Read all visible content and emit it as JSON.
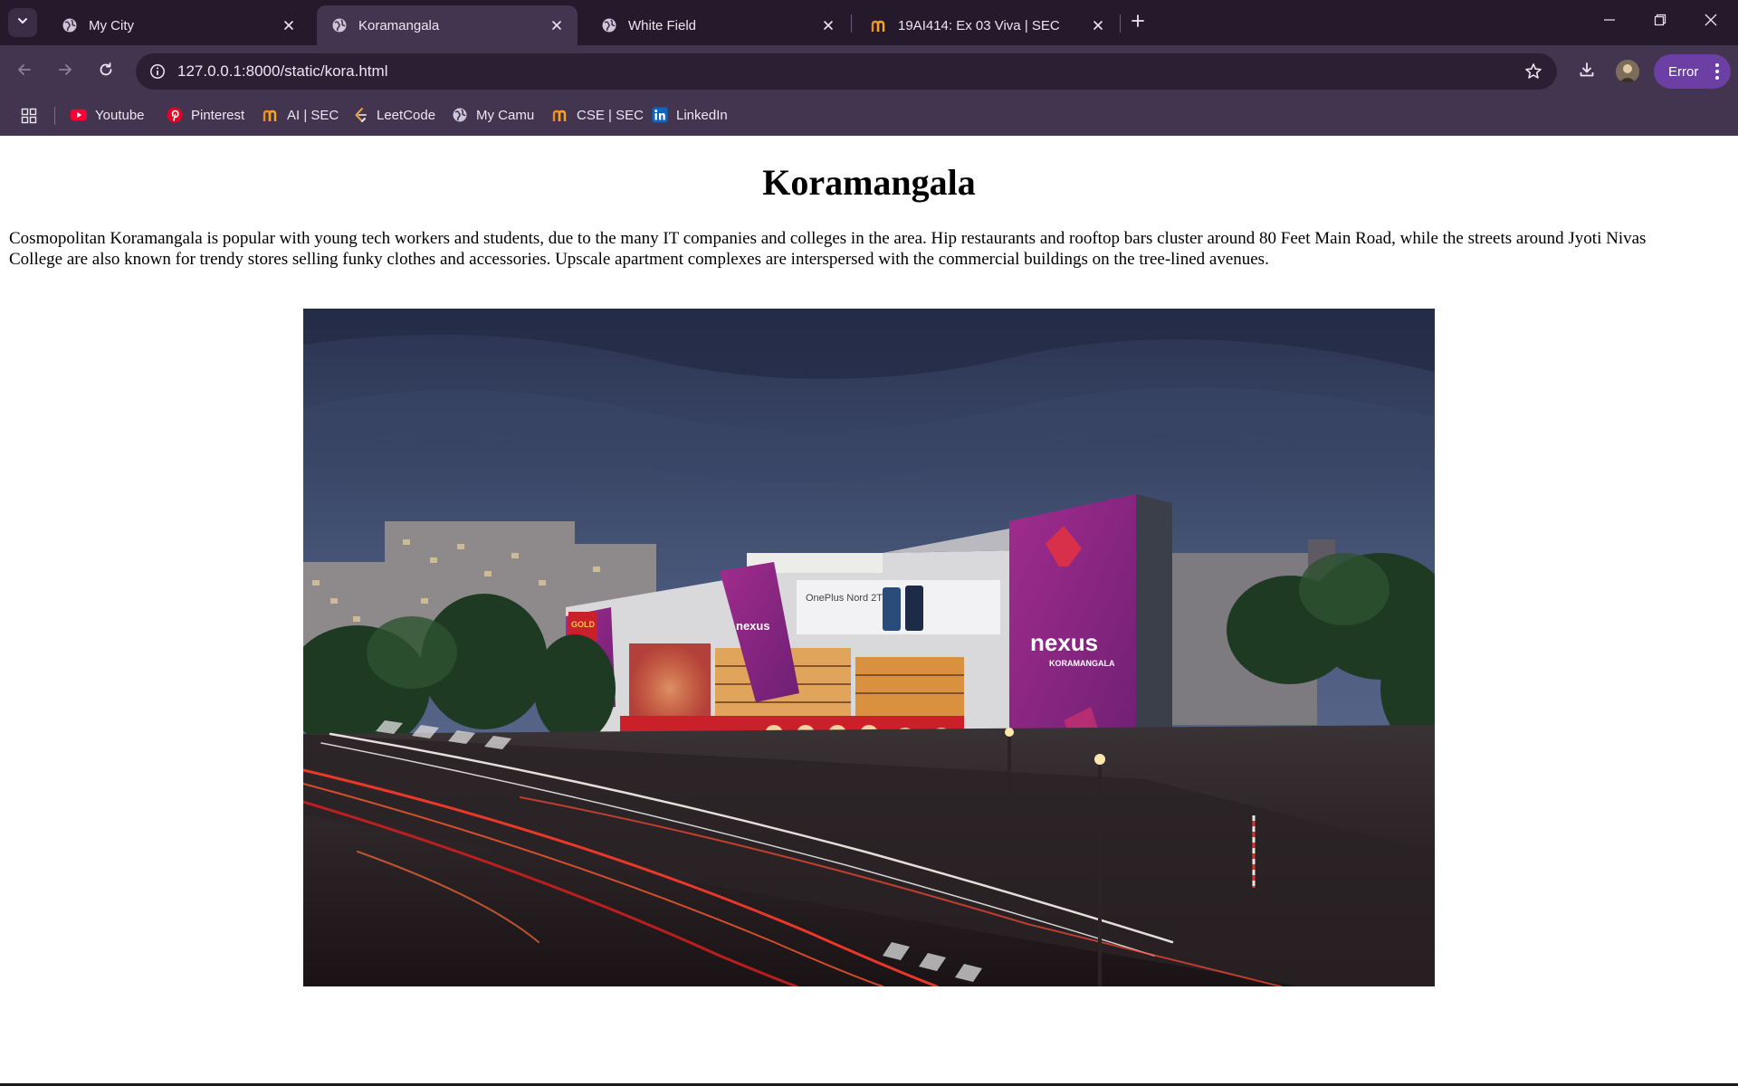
{
  "browser": {
    "tabs": [
      {
        "title": "My City",
        "favicon": "globe-icon",
        "active": false
      },
      {
        "title": "Koramangala",
        "favicon": "globe-icon",
        "active": true
      },
      {
        "title": "White Field",
        "favicon": "globe-icon",
        "active": false
      },
      {
        "title": "19AI414: Ex 03 Viva | SEC",
        "favicon": "camu-logo-icon",
        "active": false
      }
    ],
    "address_bar": {
      "url": "127.0.0.1:8000/static/kora.html"
    },
    "profile_status": "Error",
    "bookmarks": [
      {
        "label": "Youtube",
        "icon": "youtube-icon"
      },
      {
        "label": "Pinterest",
        "icon": "pinterest-icon"
      },
      {
        "label": "AI | SEC",
        "icon": "camu-logo-icon"
      },
      {
        "label": "LeetCode",
        "icon": "leetcode-icon"
      },
      {
        "label": "My Camu",
        "icon": "globe-icon"
      },
      {
        "label": "CSE | SEC",
        "icon": "camu-logo-icon"
      },
      {
        "label": "LinkedIn",
        "icon": "linkedin-icon"
      }
    ],
    "colors": {
      "frame": "#241a2c",
      "toolbar": "#43354f",
      "omnibox": "#2b2033",
      "error_pill": "#6b3fa3"
    }
  },
  "page": {
    "heading": "Koramangala",
    "paragraph": "Cosmopolitan Koramangala is popular with young tech workers and students, due to the many IT companies and colleges in the area. Hip restaurants and rooftop bars cluster around 80 Feet Main Road, while the streets around Jyoti Nivas College are also known for trendy stores selling funky clothes and accessories. Upscale apartment complexes are interspersed with the commercial buildings on the tree-lined avenues.",
    "photo": {
      "signs": {
        "brand": "nexus",
        "brand_sub": "KORAMANGALA",
        "billboard": "OnePlus Nord 2T",
        "gold_sign": "GOLD"
      }
    }
  }
}
